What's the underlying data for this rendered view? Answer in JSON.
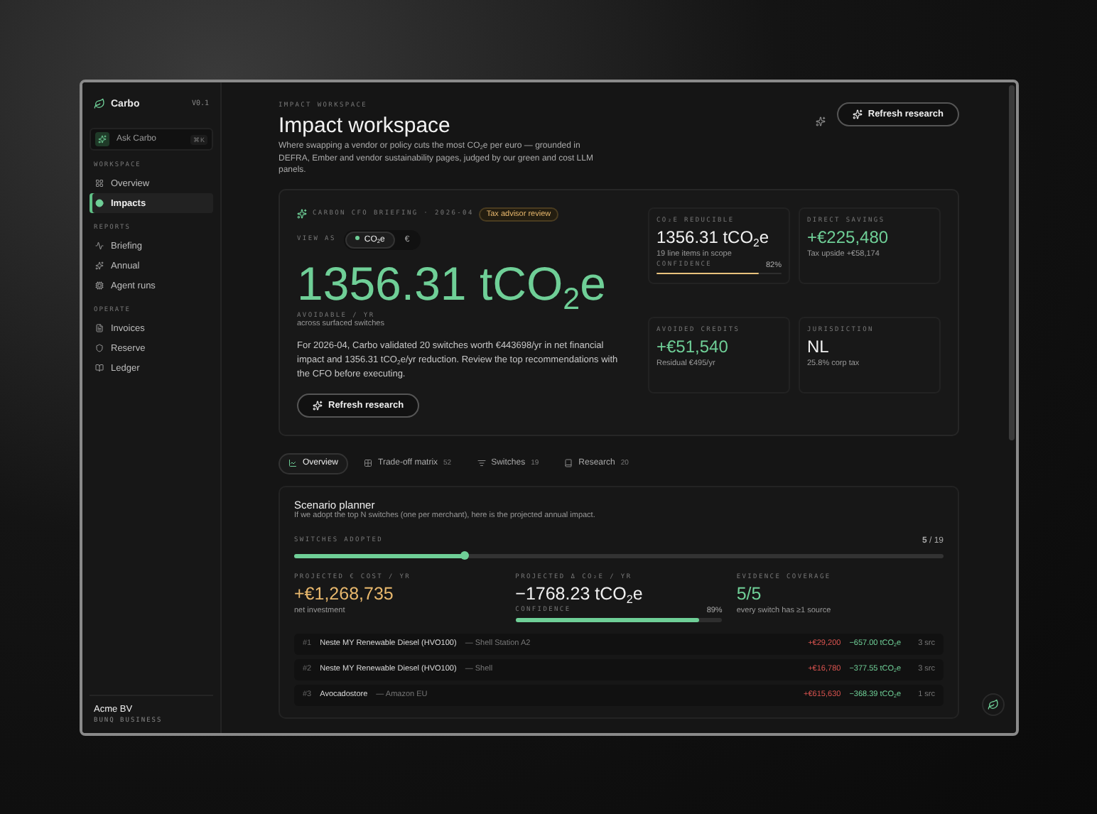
{
  "sidebar": {
    "brand": "Carbo",
    "version": "V0.1",
    "ask": {
      "label": "Ask Carbo",
      "shortcut": "⌘K"
    },
    "sections": [
      {
        "label": "WORKSPACE",
        "items": [
          {
            "label": "Overview",
            "selected": false
          },
          {
            "label": "Impacts",
            "selected": true
          }
        ]
      },
      {
        "label": "REPORTS",
        "items": [
          {
            "label": "Briefing",
            "selected": false
          },
          {
            "label": "Annual",
            "selected": false
          },
          {
            "label": "Agent runs",
            "selected": false
          }
        ]
      },
      {
        "label": "OPERATE",
        "items": [
          {
            "label": "Invoices",
            "selected": false
          },
          {
            "label": "Reserve",
            "selected": false
          },
          {
            "label": "Ledger",
            "selected": false
          }
        ]
      }
    ],
    "org": {
      "name": "Acme BV",
      "plan": "BUNQ BUSINESS"
    }
  },
  "header": {
    "eyebrow": "IMPACT WORKSPACE",
    "title": "Impact workspace",
    "description": "Where swapping a vendor or policy cuts the most CO$_{2}$e per euro — grounded in DEFRA, Ember and vendor sustainability pages, judged by our green and cost LLM panels.",
    "action": "Refresh research"
  },
  "briefing": {
    "eyebrow": "CARBON CFO BRIEFING · 2026-04",
    "badge": "Tax advisor review",
    "view_label": "VIEW AS",
    "view_options": [
      {
        "label": "CO$_{2}$e",
        "selected": true
      },
      {
        "label": "€",
        "selected": false
      }
    ],
    "headline": "1356.31 tCO$_{2}$e",
    "headline_label": "AVOIDABLE / YR",
    "headline_sub": "across surfaced switches",
    "summary": "For 2026-04, Carbo validated 20 switches worth €443698/yr in net financial impact and 1356.31 tCO$_{2}$e/yr reduction. Review the top recommendations with the CFO before executing.",
    "action": "Refresh research",
    "stats": [
      {
        "label": "CO₂E REDUCIBLE",
        "value": "1356.31 tCO$_{2}$e",
        "color": "#f0f0f0",
        "note": "19 line items in scope",
        "confidence": {
          "label": "CONFIDENCE",
          "reading": "82%",
          "level": 0.82
        }
      },
      {
        "label": "DIRECT SAVINGS",
        "value": "+€225,480",
        "color": "#6fcf97",
        "note": "Tax upside +€58,174"
      },
      {
        "label": "AVOIDED CREDITS",
        "value": "+€51,540",
        "color": "#6fcf97",
        "note": "Residual €495/yr"
      },
      {
        "label": "JURISDICTION",
        "value": "NL",
        "color": "#f0f0f0",
        "note": "25.8% corp tax"
      }
    ]
  },
  "tabs": [
    {
      "label": "Overview",
      "selected": true
    },
    {
      "label": "Trade-off matrix",
      "count": "52",
      "selected": false
    },
    {
      "label": "Switches",
      "count": "19",
      "selected": false
    },
    {
      "label": "Research",
      "count": "20",
      "selected": false
    }
  ],
  "scenario": {
    "title": "Scenario planner",
    "subtitle": "If we adopt the top N switches (one per merchant), here is the projected annual impact.",
    "slider_label": "SWITCHES ADOPTED",
    "slider_current": "5",
    "slider_total": "/ 19",
    "level": 0.263,
    "metrics": [
      {
        "label": "PROJECTED € COST / YR",
        "value": "+€1,268,735",
        "color": "#e8b86d",
        "note": "net investment"
      },
      {
        "label": "PROJECTED Δ CO₂E / YR",
        "value": "−1768.23 tCO$_{2}$e",
        "color": "#f0f0f0",
        "confidence": {
          "label": "CONFIDENCE",
          "reading": "89%",
          "level": 0.89
        }
      },
      {
        "label": "EVIDENCE COVERAGE",
        "value": "5/5",
        "color": "#6fcf97",
        "note": "every switch has ≥1 source"
      }
    ],
    "rows": [
      {
        "rank": "#1",
        "product": "Neste MY Renewable Diesel (HVO100)",
        "merchant": "— Shell Station A2",
        "cost": "+€29,200",
        "co2": "−657.00 tCO$_{2}$e",
        "sources": "3 src"
      },
      {
        "rank": "#2",
        "product": "Neste MY Renewable Diesel (HVO100)",
        "merchant": "— Shell",
        "cost": "+€16,780",
        "co2": "−377.55 tCO$_{2}$e",
        "sources": "3 src"
      },
      {
        "rank": "#3",
        "product": "Avocadostore",
        "merchant": "— Amazon EU",
        "cost": "+€615,630",
        "co2": "−368.39 tCO$_{2}$e",
        "sources": "1 src"
      }
    ]
  }
}
